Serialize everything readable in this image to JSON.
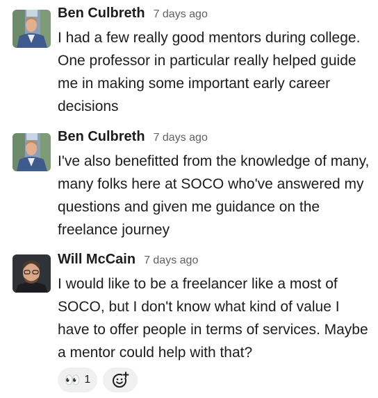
{
  "messages": [
    {
      "author": "Ben Culbreth",
      "timestamp": "7 days ago",
      "avatar": "ben-culbreth-avatar",
      "text": "I had a few really good mentors during college. One professor in particular really helped guide me in making some important early career decisions"
    },
    {
      "author": "Ben Culbreth",
      "timestamp": "7 days ago",
      "avatar": "ben-culbreth-avatar",
      "text": "I've also benefitted from the knowledge of many, many folks here at SOCO who've answered my questions and given me guidance on the freelance journey"
    },
    {
      "author": "Will McCain",
      "timestamp": "7 days ago",
      "avatar": "will-mccain-avatar",
      "text": "I would like to be a freelancer like a most of SOCO, but I don't know what kind of value I have to offer people in terms of services. Maybe a mentor could help with that?"
    }
  ],
  "reactions": [
    {
      "emoji": "👀",
      "count": "1",
      "icon": "eyes-emoji"
    }
  ],
  "add_reaction_icon": "add-reaction-icon",
  "colors": {
    "text": "#1d1c1d",
    "muted": "#616061",
    "pill": "#f0f0f0"
  }
}
